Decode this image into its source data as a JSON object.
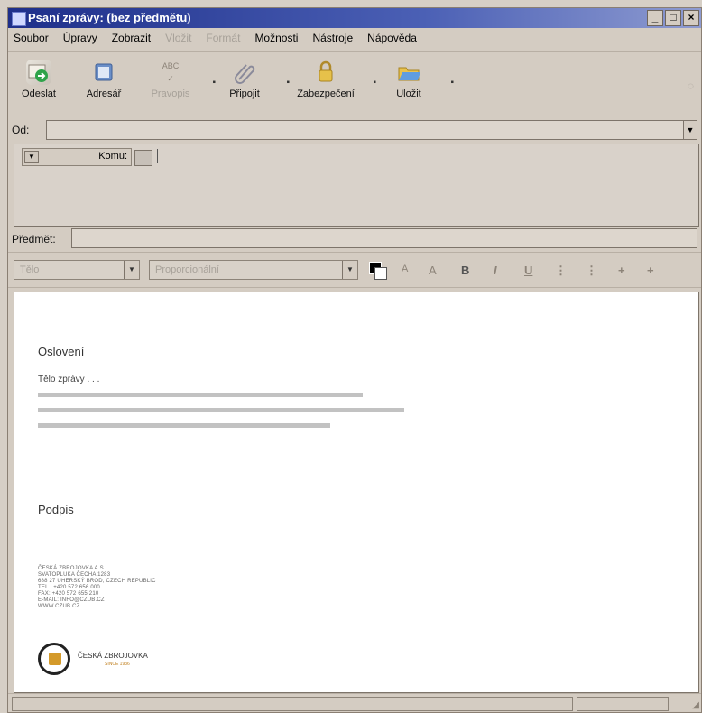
{
  "window": {
    "title": "Psaní zprávy: (bez předmětu)",
    "controls": [
      "_",
      "□",
      "×"
    ]
  },
  "menu": [
    {
      "label": "Soubor",
      "enabled": true
    },
    {
      "label": "Úpravy",
      "enabled": true
    },
    {
      "label": "Zobrazit",
      "enabled": true
    },
    {
      "label": "Vložit",
      "enabled": false
    },
    {
      "label": "Formát",
      "enabled": false
    },
    {
      "label": "Možnosti",
      "enabled": true
    },
    {
      "label": "Nástroje",
      "enabled": true
    },
    {
      "label": "Nápověda",
      "enabled": true
    }
  ],
  "toolbar": {
    "send": "Odeslat",
    "address": "Adresář",
    "spell": "Pravopis",
    "attach": "Připojit",
    "security": "Zabezpečení",
    "save": "Uložit",
    "spell_icon_text": "ABC"
  },
  "from": {
    "label": "Od:",
    "value": ""
  },
  "to": {
    "label": "Komu:"
  },
  "subject": {
    "label": "Předmět:",
    "value": ""
  },
  "format": {
    "paragraph_style": "Tělo",
    "font": "Proporcionální",
    "buttons": [
      "A",
      "A",
      "B",
      "I",
      "U",
      "⋮",
      "⋮",
      "+",
      "+"
    ]
  },
  "compose": {
    "greeting": "Oslovení",
    "body": "Tělo zprávy . . .",
    "signature": "Podpis",
    "address_lines": [
      "ČESKÁ ZBROJOVKA A.S.",
      "SVATOPLUKA ČECHA 1283",
      "688 27 UHERSKÝ BROD, CZECH REPUBLIC",
      "TEL.: +420 572 656 000",
      "FAX: +420 572 655 210",
      "E-MAIL: INFO@CZUB.CZ",
      "WWW.CZUB.CZ"
    ],
    "logo_text": "ČESKÁ ZBROJOVKA",
    "logo_sub": "SINCE 1936"
  },
  "colors": {
    "title_start": "#1e2f8a",
    "title_end": "#8e9bd1",
    "chrome": "#d4ccc2",
    "disabled_text": "#a7a199",
    "placeholder_line": "#c2c2c2",
    "logo_accent": "#d49a2a"
  }
}
